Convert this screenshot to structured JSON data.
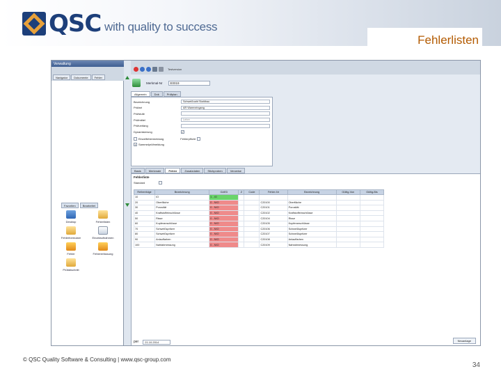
{
  "slide": {
    "logo_text": "QSC",
    "tagline": "with quality to success",
    "title": "Fehlerlisten",
    "footer": "© QSC Quality Software & Consulting | www.qsc-group.com",
    "page_number": "34"
  },
  "app": {
    "window_title": "Verwaltung",
    "toolbar_label": "Testversion",
    "left_tabs": [
      "Navigator",
      "Dokumente",
      "Fehler"
    ],
    "lower_tabs": [
      "Favoriten",
      "Bearbeitet"
    ],
    "apps": [
      "Desktop",
      "Fehlerlisten",
      "Fehlerformulare",
      "Einzelaufnahmen",
      "Fehler",
      "Fehlererfassung",
      "Prüfabschnitt"
    ],
    "record": {
      "label": "Merkmal-Nr",
      "value": "E0019"
    },
    "subtabs": [
      "Allgemein",
      "Dok",
      "Prüfplan"
    ],
    "form": {
      "fields": [
        {
          "label": "Bezeichnung",
          "value": "Schweißnaht Stahlbau"
        },
        {
          "label": "Prüfart",
          "value": "AR  Wareneingang"
        },
        {
          "label": "Prüfstufe",
          "value": ""
        },
        {
          "label": "Prüfmittel",
          "value": "Lehre"
        },
        {
          "label": "Prüfumfang",
          "value": ""
        }
      ],
      "dyn_label": "Dynamisierung",
      "opt1": "Einzelfehlermeldung",
      "opt2": "Sammelprüfmeldung",
      "fehlerpflicht": "Fehlerpflicht"
    },
    "plan_tabs": [
      "Basis",
      "Merkmale",
      "Fehler",
      "Zusatzdaten",
      "Stichproben",
      "Verweise"
    ],
    "plan": {
      "title": "Fehlerliste",
      "standard_label": "Standard",
      "columns": [
        "Reihenfolge",
        "Bezeichnung",
        "GAED",
        "Z",
        "Code",
        "Fehler-Nr",
        "Bezeichnung",
        "Gültig-Von",
        "Gültig-Bis"
      ],
      "rows": [
        {
          "seq": "10",
          "name": "IO",
          "rating": "1 - IO",
          "status": "g",
          "code": "",
          "fnr": "",
          "fname": ""
        },
        {
          "seq": "20",
          "name": "Oberfläche",
          "rating": "0 - NIO",
          "status": "r",
          "code": "",
          "fnr": "C20100",
          "fname": "Oberfläche"
        },
        {
          "seq": "30",
          "name": "Porosität",
          "rating": "0 - NIO",
          "status": "r",
          "code": "",
          "fnr": "C20101",
          "fname": "Porosität"
        },
        {
          "seq": "40",
          "name": "Kraftstoffeinschlüsse",
          "rating": "0 - NIO",
          "status": "r",
          "code": "",
          "fnr": "C20102",
          "fname": "Kraftstoffeinschlüsse"
        },
        {
          "seq": "50",
          "name": "Risse",
          "rating": "0 - NIO",
          "status": "r",
          "code": "",
          "fnr": "C20104",
          "fname": "Risse"
        },
        {
          "seq": "60",
          "name": "Kupferanschlüsse",
          "rating": "0 - NIO",
          "status": "r",
          "code": "",
          "fnr": "C20105",
          "fname": "Kupferanschlüsse"
        },
        {
          "seq": "70",
          "name": "Schweißspritzer",
          "rating": "0 - NIO",
          "status": "r",
          "code": "",
          "fnr": "C20106",
          "fname": "Schweißspritzer"
        },
        {
          "seq": "80",
          "name": "Schweißspritzer",
          "rating": "0 - NIO",
          "status": "r",
          "code": "",
          "fnr": "C20107",
          "fname": "Schweißspritzer"
        },
        {
          "seq": "90",
          "name": "Anlauffarben",
          "rating": "0 - NIO",
          "status": "r",
          "code": "",
          "fnr": "C20108",
          "fname": "Anlauffarben"
        },
        {
          "seq": "100",
          "name": "Nahtabmessung",
          "rating": "0 - NIO",
          "status": "r",
          "code": "",
          "fnr": "C20109",
          "fname": "Nahtabmessung"
        }
      ]
    },
    "bottom": {
      "label": "per",
      "date": "21.10.2014",
      "new_button": "Neuanlage"
    }
  }
}
